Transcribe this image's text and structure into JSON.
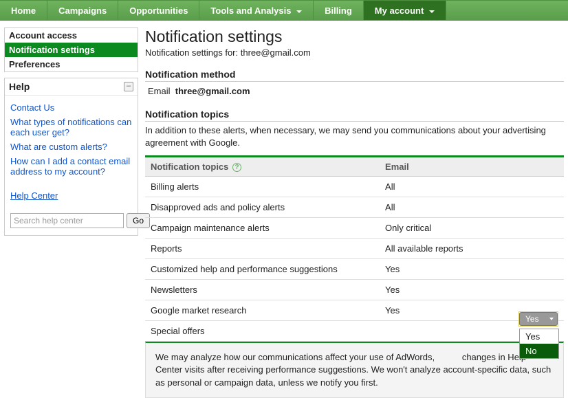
{
  "nav": {
    "home": "Home",
    "campaigns": "Campaigns",
    "opportunities": "Opportunities",
    "tools": "Tools and Analysis",
    "billing": "Billing",
    "account": "My account"
  },
  "sidebar": {
    "items": [
      {
        "label": "Account access"
      },
      {
        "label": "Notification settings"
      },
      {
        "label": "Preferences"
      }
    ]
  },
  "help": {
    "title": "Help",
    "links": {
      "contact": "Contact Us",
      "types": "What types of notifications can each user get?",
      "custom": "What are custom alerts?",
      "addemail": "How can I add a contact email address to my account?",
      "center": "Help Center"
    },
    "search_placeholder": "Search help center",
    "go": "Go"
  },
  "page": {
    "title": "Notification settings",
    "subtitle_prefix": "Notification settings for: ",
    "user_email": "three@gmail.com",
    "method_heading": "Notification method",
    "method_label": "Email",
    "method_value": "three@gmail.com",
    "topics_heading": "Notification topics",
    "topics_desc": "In addition to these alerts, when necessary, we may send you communications about your advertising agreement with Google."
  },
  "table": {
    "col_topic": "Notification topics",
    "col_email": "Email",
    "rows": [
      {
        "topic": "Billing alerts",
        "value": "All"
      },
      {
        "topic": "Disapproved ads and policy alerts",
        "value": "All"
      },
      {
        "topic": "Campaign maintenance alerts",
        "value": "Only critical"
      },
      {
        "topic": "Reports",
        "value": "All available reports"
      },
      {
        "topic": "Customized help and performance suggestions",
        "value": "Yes"
      },
      {
        "topic": "Newsletters",
        "value": "Yes"
      },
      {
        "topic": "Google market research",
        "value": "Yes"
      },
      {
        "topic": "Special offers",
        "value": "Yes"
      }
    ]
  },
  "dropdown": {
    "selected": "Yes",
    "options": {
      "yes": "Yes",
      "no": "No"
    }
  },
  "footer": {
    "text_a": "We may analyze how our communications affect your use of AdWords, ",
    "text_b": " changes in Help Center visits after receiving performance suggestions. We won't analyze account-specific data, such as personal or campaign data, unless we notify you first."
  }
}
